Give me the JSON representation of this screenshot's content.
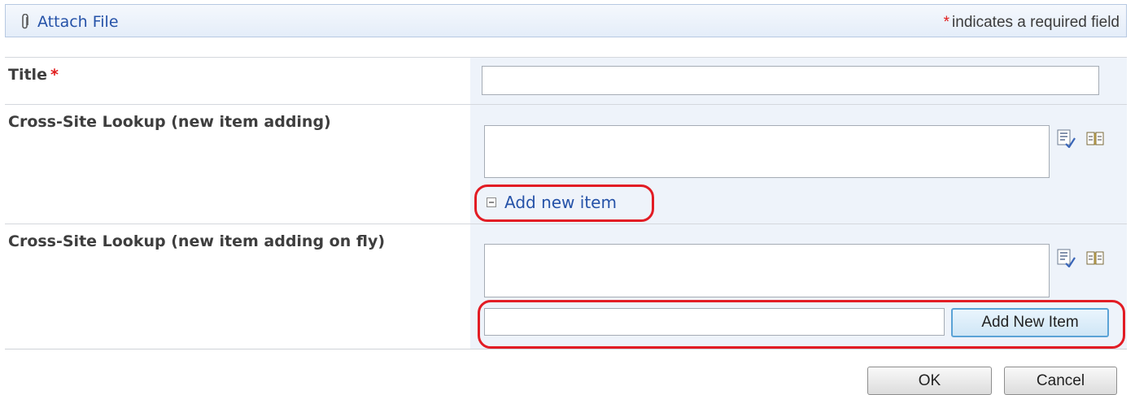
{
  "toolbar": {
    "attach_label": "Attach File",
    "required_star": "*",
    "required_text": "indicates a required field"
  },
  "fields": {
    "title": {
      "label": "Title",
      "star": "*",
      "value": ""
    },
    "lookup1": {
      "label": "Cross-Site Lookup (new item adding)",
      "add_link": "Add new item"
    },
    "lookup2": {
      "label": "Cross-Site Lookup (new item adding on fly)",
      "new_item_value": "",
      "add_button": "Add New Item"
    }
  },
  "footer": {
    "ok_label": "OK",
    "cancel_label": "Cancel"
  },
  "colors": {
    "accent": "#2552a8",
    "required": "#e01b1b",
    "highlight": "#e21c24",
    "value_bg": "#eef3fa"
  },
  "icons": [
    "paperclip-icon",
    "browse-list-icon",
    "address-book-icon"
  ]
}
